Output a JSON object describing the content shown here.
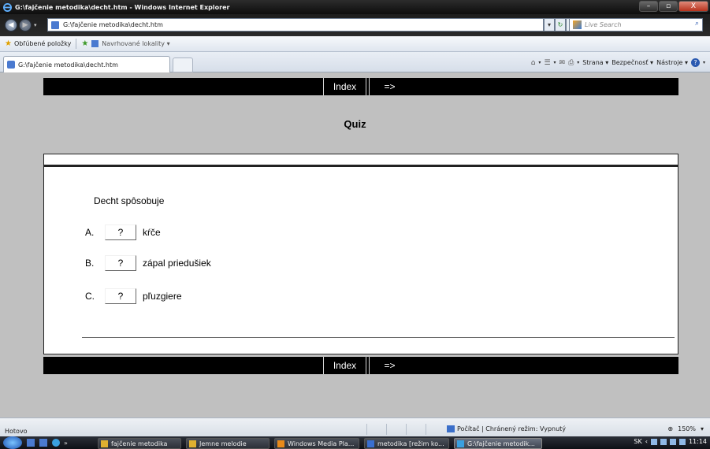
{
  "window": {
    "title": "G:\\fajčenie metodika\\decht.htm - Windows Internet Explorer",
    "buttons": {
      "minimize": "–",
      "maximize": "▫",
      "close": "X"
    }
  },
  "addressbar": {
    "back": "◀",
    "forward": "▶",
    "dropdown": "▾",
    "url": "G:\\fajčenie metodika\\decht.htm",
    "go_dropdown": "▾",
    "refresh": "↻",
    "stop": "✕",
    "search_placeholder": "Live Search",
    "search_button": "⌕"
  },
  "favorites": {
    "label": "Obľúbené položky",
    "suggested": "Navrhované lokality ▾"
  },
  "tab": {
    "label": "G:\\fajčenie metodika\\decht.htm"
  },
  "commandbar": {
    "home": "⌂",
    "feeds": "☰",
    "mail": "✉",
    "print": "⎙",
    "page": "Strana ▾",
    "safety": "Bezpečnosť ▾",
    "tools": "Nástroje ▾",
    "help": "?"
  },
  "page": {
    "nav": {
      "index": "Index",
      "next": "=>"
    },
    "title": "Quiz",
    "question": "Decht spôsobuje",
    "options": [
      {
        "letter": "A.",
        "box": "?",
        "text": "kŕče"
      },
      {
        "letter": "B.",
        "box": "?",
        "text": "zápal priedušiek"
      },
      {
        "letter": "C.",
        "box": "?",
        "text": "pľuzgiere"
      }
    ]
  },
  "status": {
    "left": "Hotovo",
    "zone": "Počítač | Chránený režim: Vypnutý",
    "zoom": "150%",
    "zoom_caret": "▾"
  },
  "taskbar": {
    "chevron": "»",
    "tasks": [
      "fajčenie metodika",
      "Jemne melodie",
      "Windows Media Pla...",
      "metodika [režim ko...",
      "G:\\fajčenie metodik..."
    ],
    "language": "SK",
    "clock": "11:14"
  },
  "colors": {
    "page_background": "#c0c0c0",
    "nav_bar": "#000000",
    "panel": "#ffffff"
  }
}
